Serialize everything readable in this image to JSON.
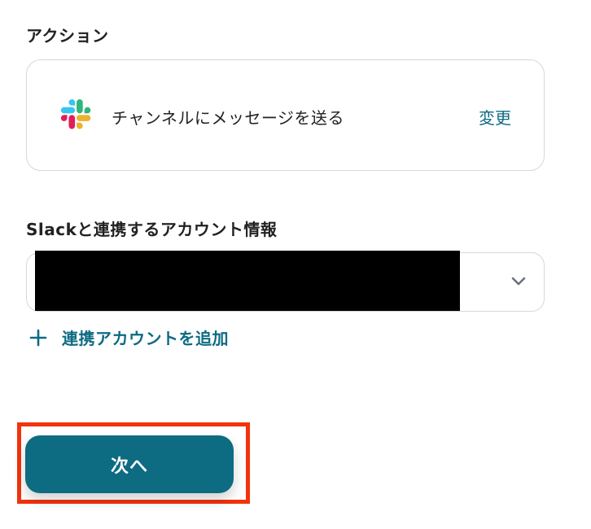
{
  "action": {
    "section_label": "アクション",
    "app_icon": "slack-icon",
    "description": "チャンネルにメッセージを送る",
    "change_label": "変更"
  },
  "account": {
    "section_label": "Slackと連携するアカウント情報",
    "selected_value": "",
    "add_label": "連携アカウントを追加"
  },
  "next_button": {
    "label": "次へ"
  },
  "colors": {
    "accent": "#0d6b82",
    "highlight": "#f2330d",
    "border": "#d4d8dd"
  }
}
